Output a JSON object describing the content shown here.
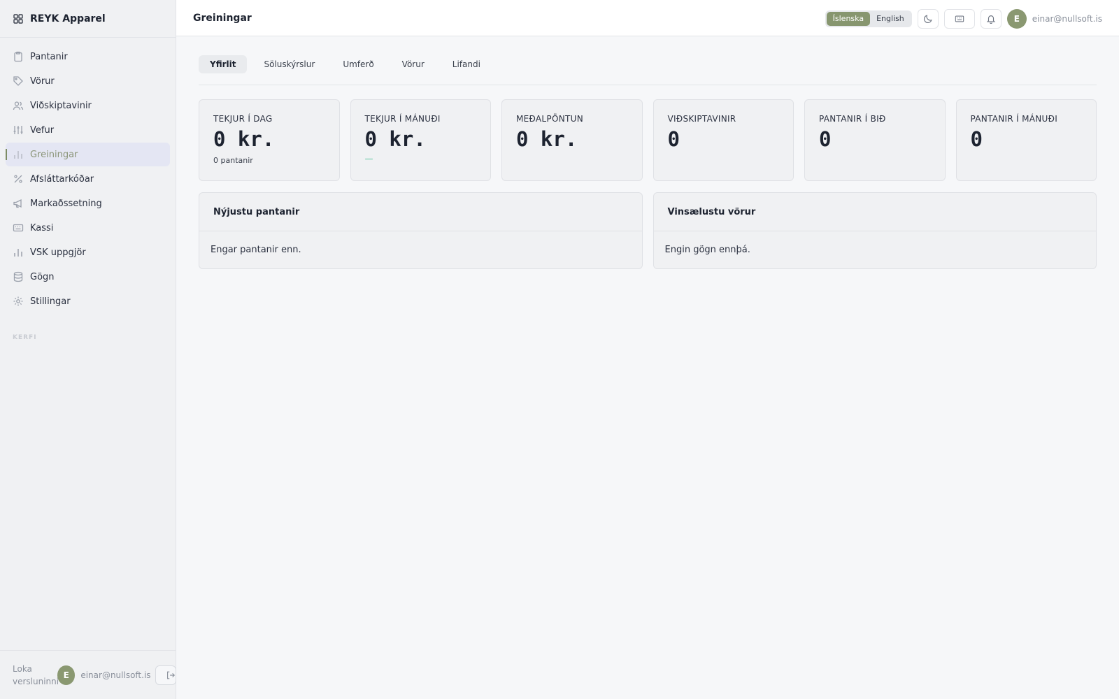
{
  "brand": {
    "name": "REYK Apparel"
  },
  "sidebar": {
    "items": [
      {
        "label": "Pantanir",
        "icon": "clipboard-icon"
      },
      {
        "label": "Vörur",
        "icon": "tag-icon"
      },
      {
        "label": "Viðskiptavinir",
        "icon": "users-icon"
      },
      {
        "label": "Vefur",
        "icon": "sliders-icon"
      },
      {
        "label": "Greiningar",
        "icon": "bar-chart-icon",
        "active": true
      },
      {
        "label": "Afsláttarkóðar",
        "icon": "percent-icon"
      },
      {
        "label": "Markaðssetning",
        "icon": "megaphone-icon"
      },
      {
        "label": "Kassi",
        "icon": "keyboard-icon"
      },
      {
        "label": "VSK uppgjör",
        "icon": "bar-chart-icon"
      },
      {
        "label": "Gögn",
        "icon": "database-icon"
      },
      {
        "label": "Stillingar",
        "icon": "gear-icon"
      }
    ],
    "section_label": "KERFI",
    "footer": {
      "close_shop": "Loka versluninni",
      "avatar_initial": "E",
      "email": "einar@nullsoft.is"
    }
  },
  "header": {
    "title": "Greiningar",
    "languages": [
      "Íslenska",
      "English"
    ],
    "active_language": "Íslenska",
    "avatar_initial": "E",
    "email": "einar@nullsoft.is"
  },
  "tabs": [
    {
      "label": "Yfirlit",
      "active": true
    },
    {
      "label": "Söluskýrslur"
    },
    {
      "label": "Umferð"
    },
    {
      "label": "Vörur"
    },
    {
      "label": "Lifandi"
    }
  ],
  "stats": [
    {
      "label": "TEKJUR Í DAG",
      "value": "0 kr.",
      "sub": "0 pantanir"
    },
    {
      "label": "TEKJUR Í MÁNUÐI",
      "value": "0 kr.",
      "sub": "—"
    },
    {
      "label": "MEÐALPÖNTUN",
      "value": "0 kr."
    },
    {
      "label": "VIÐSKIPTAVINIR",
      "value": "0"
    },
    {
      "label": "PANTANIR Í BIÐ",
      "value": "0"
    },
    {
      "label": "PANTANIR Í MÁNUÐI",
      "value": "0"
    }
  ],
  "panels": {
    "recent_orders": {
      "title": "Nýjustu pantanir",
      "empty": "Engar pantanir enn."
    },
    "popular_products": {
      "title": "Vinsælustu vörur",
      "empty": "Engin gögn ennþá."
    }
  },
  "colors": {
    "accent": "#87966f",
    "active_nav_bg": "#e4e6f3",
    "positive": "#4bc095"
  }
}
